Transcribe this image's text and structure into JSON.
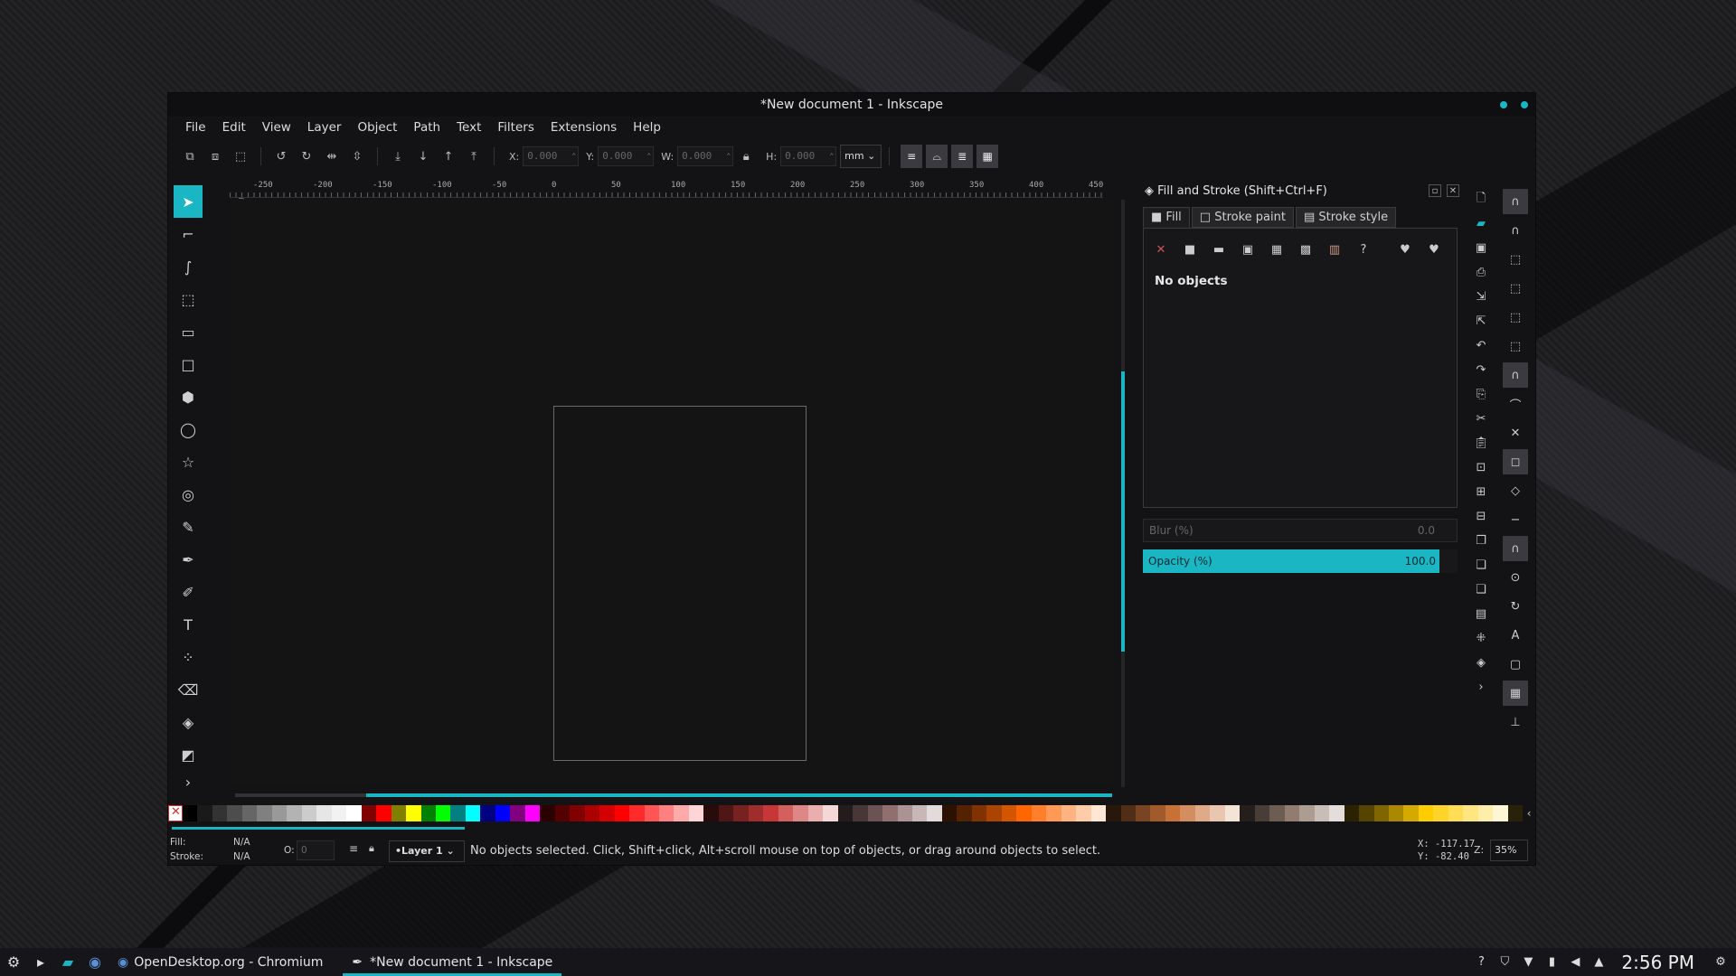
{
  "window": {
    "title": "*New document 1 - Inkscape"
  },
  "menu": [
    "File",
    "Edit",
    "View",
    "Layer",
    "Object",
    "Path",
    "Text",
    "Filters",
    "Extensions",
    "Help"
  ],
  "toolcontrols": {
    "x_label": "X:",
    "x_value": "0.000",
    "y_label": "Y:",
    "y_value": "0.000",
    "w_label": "W:",
    "w_value": "0.000",
    "h_label": "H:",
    "h_value": "0.000",
    "unit": "mm"
  },
  "ruler_top": [
    "-250",
    "-200",
    "-150",
    "-100",
    "-50",
    "0",
    "50",
    "100",
    "150",
    "200",
    "250",
    "300",
    "350",
    "400",
    "450"
  ],
  "dialog": {
    "title": "Fill and Stroke (Shift+Ctrl+F)",
    "tabs": [
      "Fill",
      "Stroke paint",
      "Stroke style"
    ],
    "message": "No objects",
    "blur_label": "Blur (%)",
    "blur_value": "0.0",
    "opacity_label": "Opacity (%)",
    "opacity_value": "100.0"
  },
  "palette_colors": [
    "#000000",
    "#1a1a1a",
    "#333333",
    "#4d4d4d",
    "#666666",
    "#808080",
    "#999999",
    "#b3b3b3",
    "#cccccc",
    "#e6e6e6",
    "#f2f2f2",
    "#ffffff",
    "#800000",
    "#ff0000",
    "#808000",
    "#ffff00",
    "#008000",
    "#00ff00",
    "#008080",
    "#00ffff",
    "#000080",
    "#0000ff",
    "#800080",
    "#ff00ff",
    "#2b0000",
    "#550000",
    "#800000",
    "#aa0000",
    "#d40000",
    "#ff0000",
    "#ff2a2a",
    "#ff5555",
    "#ff8080",
    "#ffaaaa",
    "#ffd5d5",
    "#280b0b",
    "#501616",
    "#782121",
    "#a02c2c",
    "#c83737",
    "#d35f5f",
    "#de8787",
    "#e9afaf",
    "#f4d7d7",
    "#241c1c",
    "#483737",
    "#6c5353",
    "#916f6f",
    "#ac9393",
    "#c8b7b7",
    "#e3dbdb",
    "#2b1100",
    "#552200",
    "#803300",
    "#aa4400",
    "#d45500",
    "#ff6600",
    "#ff7f2a",
    "#ff9955",
    "#ffb380",
    "#ffccaa",
    "#ffe6d5",
    "#28170b",
    "#502d16",
    "#784421",
    "#a05a2c",
    "#c87137",
    "#d38d5f",
    "#deaa87",
    "#e9c6af",
    "#f4e3d7",
    "#241f1c",
    "#483e37",
    "#6c5d53",
    "#917c6f",
    "#ac9d93",
    "#c8beb7",
    "#e3dedb",
    "#2b2200",
    "#554400",
    "#806600",
    "#aa8800",
    "#d4aa00",
    "#ffcc00",
    "#ffd42a",
    "#ffdd55",
    "#ffe680",
    "#ffeeaa",
    "#fff6d5",
    "#28220b"
  ],
  "status": {
    "fill_label": "Fill:",
    "fill_value": "N/A",
    "stroke_label": "Stroke:",
    "stroke_value": "N/A",
    "opacity_label": "O:",
    "opacity_value": "0",
    "layer": "•Layer 1",
    "message": "No objects selected. Click, Shift+click, Alt+scroll mouse on top of objects, or drag around objects to select.",
    "x_coord": "X: -117.17",
    "y_coord": "Y:  -82.40",
    "zoom_label": "Z:",
    "zoom": "35%"
  },
  "taskbar": {
    "tasks": [
      "OpenDesktop.org - Chromium",
      "*New document 1 - Inkscape"
    ],
    "clock": "2:56 PM"
  },
  "colors": {
    "accent": "#1bb6c4",
    "window_bg": "#131316"
  }
}
